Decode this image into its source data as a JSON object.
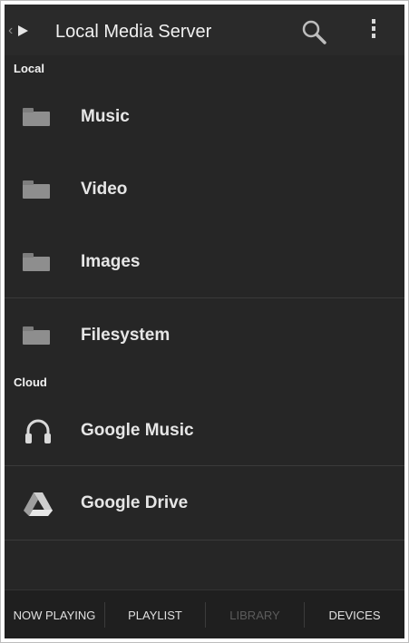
{
  "actionbar": {
    "title": "Local Media Server"
  },
  "sections": {
    "local_header": "Local",
    "cloud_header": "Cloud"
  },
  "local_items": [
    {
      "label": "Music",
      "icon": "folder-icon"
    },
    {
      "label": "Video",
      "icon": "folder-icon"
    },
    {
      "label": "Images",
      "icon": "folder-icon"
    },
    {
      "label": "Filesystem",
      "icon": "folder-icon"
    }
  ],
  "cloud_items": [
    {
      "label": "Google Music",
      "icon": "headphones-icon"
    },
    {
      "label": "Google Drive",
      "icon": "google-drive-icon"
    }
  ],
  "tabs": [
    {
      "label": "NOW PLAYING",
      "active": true
    },
    {
      "label": "PLAYLIST",
      "active": true
    },
    {
      "label": "LIBRARY",
      "active": false
    },
    {
      "label": "DEVICES",
      "active": true
    }
  ]
}
